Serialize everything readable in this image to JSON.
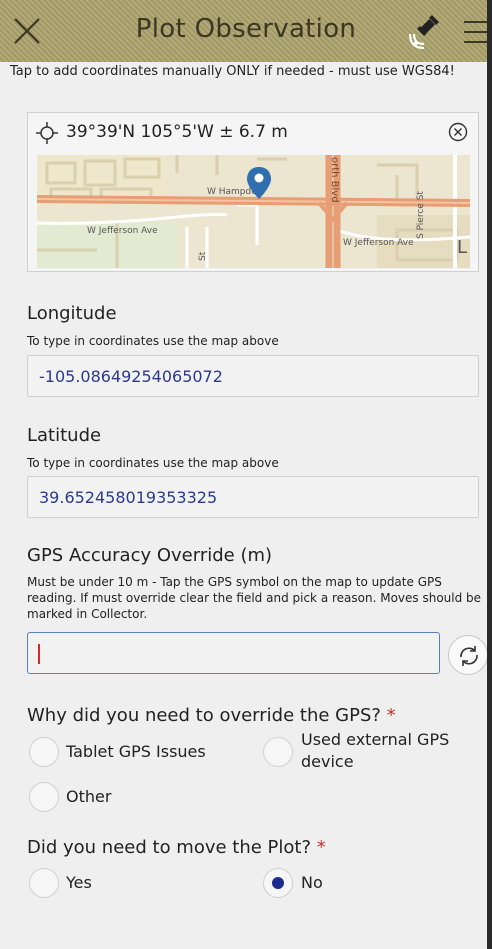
{
  "header": {
    "title": "Plot Observation",
    "icons": [
      "close-icon",
      "gps-satellite-icon",
      "menu-icon"
    ],
    "background_color": "#a9a06a"
  },
  "location": {
    "instruction": "Tap to add coordinates manually ONLY if needed - must use WGS84!",
    "coordinates_text": "39°39'N 105°5'W ± 6.7 m",
    "map_labels": {
      "street_hampden": "W Hampden",
      "street_jefferson_west": "W Jefferson Ave",
      "street_jefferson_east": "W Jefferson Ave",
      "street_blvd": "orth Blvd",
      "street_pierce": "S Pierce St",
      "street_st": "St",
      "map_corner_glyph": "L"
    }
  },
  "longitude": {
    "label": "Longitude",
    "hint": "To type in coordinates use the map above",
    "value": "-105.08649254065072"
  },
  "latitude": {
    "label": "Latitude",
    "hint": "To type in coordinates use the map above",
    "value": "39.652458019353325"
  },
  "gps_override": {
    "label": "GPS Accuracy Override (m)",
    "hint": "Must be under 10 m - Tap the GPS symbol on the map to update GPS reading. If must override clear the field and pick a reason. Moves should be marked in Collector.",
    "value": ""
  },
  "override_reason": {
    "question": "Why did you need to override the GPS?",
    "required_mark": "*",
    "options": [
      "Tablet GPS Issues",
      "Used external GPS device",
      "Other"
    ],
    "selected": null
  },
  "move_plot": {
    "question": "Did you need to move the Plot?",
    "required_mark": "*",
    "options": [
      "Yes",
      "No"
    ],
    "selected": "No"
  },
  "colors": {
    "value_text": "#2b3a8c",
    "required": "#c4302b",
    "selected_radio": "#1b2b8e",
    "map_pin": "#2f6fb0",
    "road_major": "#e79e74"
  }
}
